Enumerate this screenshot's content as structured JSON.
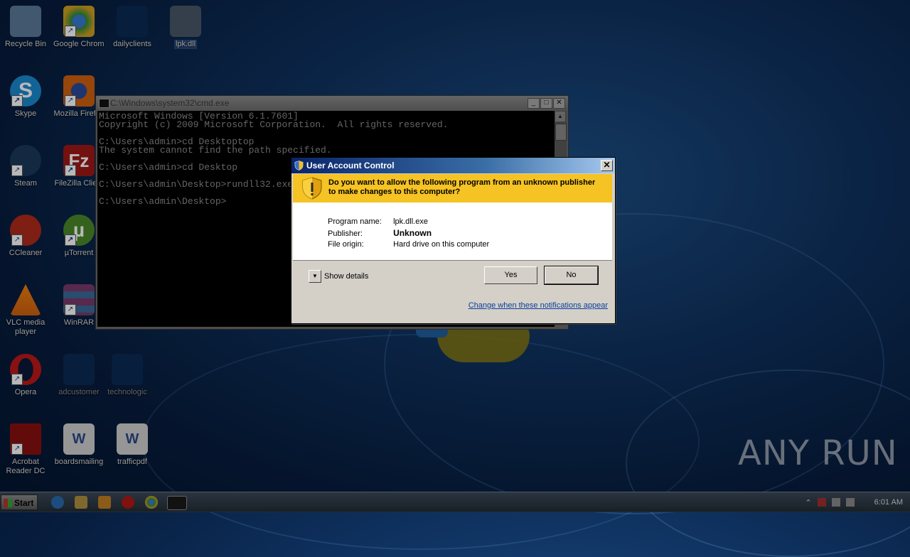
{
  "desktop": {
    "icons": [
      {
        "label": "Recycle Bin",
        "color": "#5b7a9a"
      },
      {
        "label": "Google Chrome",
        "color": "#2a8a3a"
      },
      {
        "label": "dailyclients",
        "color": "#0c2a55"
      },
      {
        "label": "lpk.dll",
        "color": "#4a5868"
      },
      {
        "label": "Skype",
        "color": "#1a8ad0"
      },
      {
        "label": "Mozilla Firefox",
        "color": "#c05a1a"
      },
      {
        "label": "Steam",
        "color": "#1a3a5a"
      },
      {
        "label": "FileZilla Client",
        "color": "#a01818"
      },
      {
        "label": "CCleaner",
        "color": "#b02a1a"
      },
      {
        "label": "µTorrent",
        "color": "#4a8a2a"
      },
      {
        "label": "VLC media player",
        "color": "#d07a10"
      },
      {
        "label": "WinRAR",
        "color": "#7a3a6a"
      },
      {
        "label": "Opera",
        "color": "#b01818"
      },
      {
        "label": "adcustomer",
        "color": "#0c2a55"
      },
      {
        "label": "technologic",
        "color": "#0c2a55"
      },
      {
        "label": "Acrobat Reader DC",
        "color": "#8a1010"
      },
      {
        "label": "boardsmailing",
        "color": "#5a6a8a"
      },
      {
        "label": "trafficpdf",
        "color": "#5a6a8a"
      }
    ]
  },
  "cmd": {
    "title": "C:\\Windows\\system32\\cmd.exe",
    "lines": [
      "Microsoft Windows [Version 6.1.7601]",
      "Copyright (c) 2009 Microsoft Corporation.  All rights reserved.",
      "",
      "C:\\Users\\admin>cd Desktoptop",
      "The system cannot find the path specified.",
      "",
      "C:\\Users\\admin>cd Desktop",
      "",
      "C:\\Users\\admin\\Desktop>rundll32.exe",
      "",
      "C:\\Users\\admin\\Desktop>"
    ]
  },
  "uac": {
    "title": "User Account Control",
    "question": "Do you want to allow the following program from an unknown publisher to make changes to this computer?",
    "program_name_label": "Program name:",
    "program_name": "lpk.dll.exe",
    "publisher_label": "Publisher:",
    "publisher": "Unknown",
    "file_origin_label": "File origin:",
    "file_origin": "Hard drive on this computer",
    "show_details": "Show details",
    "yes": "Yes",
    "no": "No",
    "change_link": "Change when these notifications appear"
  },
  "taskbar": {
    "start": "Start",
    "clock": "6:01 AM"
  },
  "watermark": "ANY RUN"
}
